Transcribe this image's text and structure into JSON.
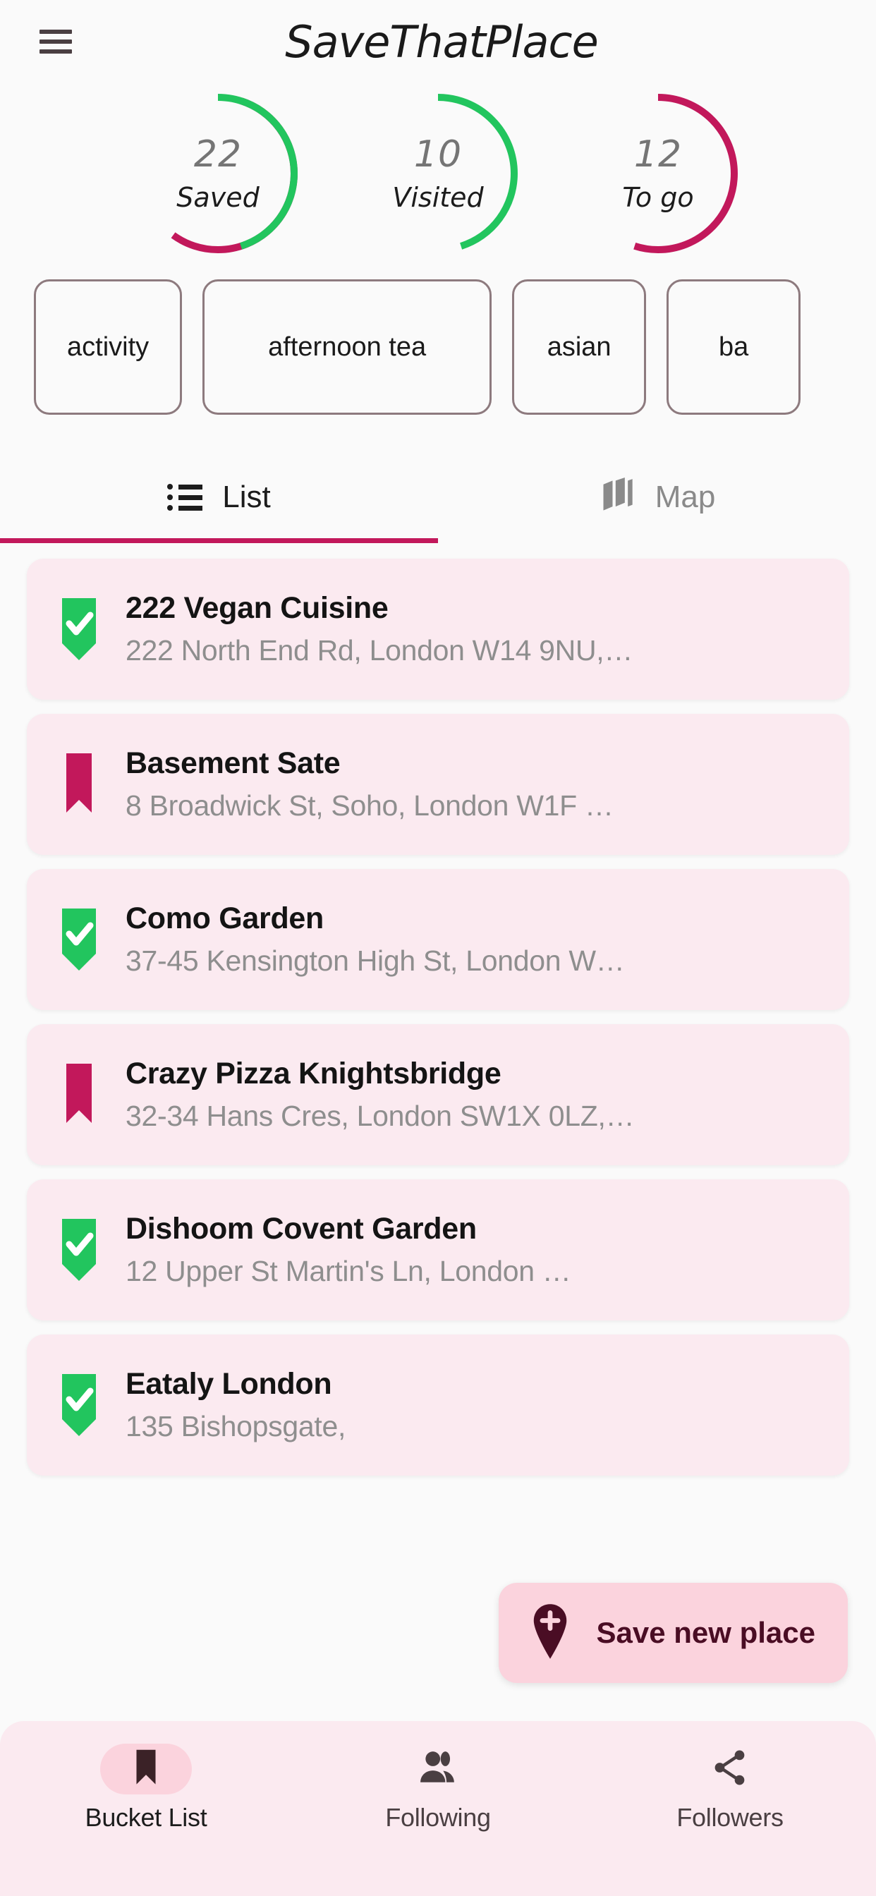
{
  "header": {
    "title": "SaveThatPlace",
    "menu_icon": "hamburger-menu-icon"
  },
  "stats": [
    {
      "count": "22",
      "label": "Saved",
      "primary_color": "#c2185b",
      "secondary_color": "#22c55e",
      "arc_kind": "split",
      "green_fraction": 0.45
    },
    {
      "count": "10",
      "label": "Visited",
      "primary_color": "#22c55e",
      "secondary_color": "",
      "arc_kind": "partial",
      "green_fraction": 0.45
    },
    {
      "count": "12",
      "label": "To go",
      "primary_color": "#c2185b",
      "secondary_color": "",
      "arc_kind": "partial",
      "green_fraction": 0.55
    }
  ],
  "chips": [
    {
      "label": "activity"
    },
    {
      "label": "afternoon tea"
    },
    {
      "label": "asian"
    },
    {
      "label": "ba"
    }
  ],
  "tabs": [
    {
      "label": "List",
      "icon": "list-icon",
      "active": true
    },
    {
      "label": "Map",
      "icon": "map-icon",
      "active": false
    }
  ],
  "places": [
    {
      "name": "222 Vegan Cuisine",
      "address": "222 North End Rd, London W14 9NU,…",
      "visited": true
    },
    {
      "name": "Basement Sate",
      "address": "8 Broadwick St, Soho, London W1F …",
      "visited": false
    },
    {
      "name": "Como Garden",
      "address": "37-45 Kensington High St, London W…",
      "visited": true
    },
    {
      "name": "Crazy Pizza Knightsbridge",
      "address": "32-34 Hans Cres, London SW1X 0LZ,…",
      "visited": false
    },
    {
      "name": "Dishoom Covent Garden",
      "address": "12 Upper St Martin's Ln, London …",
      "visited": true
    },
    {
      "name": "Eataly London",
      "address": "135 Bishopsgate,",
      "visited": true
    }
  ],
  "fab": {
    "label": "Save new place",
    "icon": "map-pin-plus-icon"
  },
  "bottom_nav": [
    {
      "label": "Bucket List",
      "icon": "bookmark-icon",
      "active": true
    },
    {
      "label": "Following",
      "icon": "people-icon",
      "active": false
    },
    {
      "label": "Followers",
      "icon": "share-icon",
      "active": false
    }
  ],
  "colors": {
    "accent": "#c2185b",
    "green": "#22c55e",
    "card_bg": "#fbeaf0",
    "nav_bg": "#fbeaf0",
    "pill_bg": "#fbd3dd",
    "page_bg": "#fafafa",
    "dark": "#4a0d24"
  }
}
